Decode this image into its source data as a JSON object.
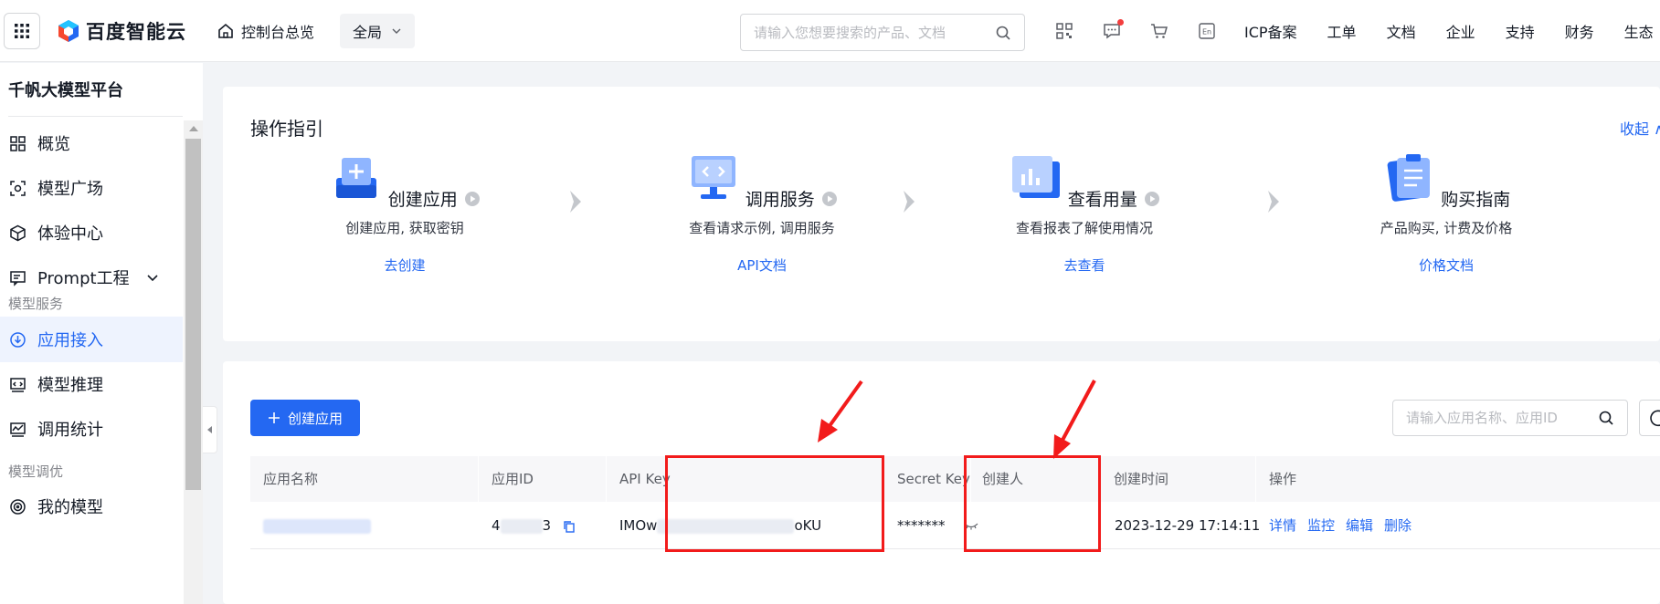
{
  "topbar": {
    "logo_text": "百度智能云",
    "console_label": "控制台总览",
    "region_label": "全局",
    "search_placeholder": "请输入您想要搜索的产品、文档",
    "nav": [
      "ICP备案",
      "工单",
      "文档",
      "企业",
      "支持",
      "财务",
      "生态"
    ],
    "icons": [
      "qrcode-icon",
      "message-icon",
      "cart-icon",
      "language-icon"
    ]
  },
  "sidebar": {
    "title": "千帆大模型平台",
    "items": [
      {
        "label": "概览",
        "icon": "grid-icon"
      },
      {
        "label": "模型广场",
        "icon": "model-icon"
      },
      {
        "label": "体验中心",
        "icon": "cube-icon"
      },
      {
        "label": "Prompt工程",
        "icon": "prompt-icon"
      }
    ],
    "group_model_service": "模型服务",
    "service_items": [
      {
        "label": "应用接入",
        "icon": "download-circle-icon",
        "active": true
      },
      {
        "label": "模型推理",
        "icon": "code-window-icon"
      },
      {
        "label": "调用统计",
        "icon": "chart-icon"
      }
    ],
    "group_model_tuning": "模型调优",
    "tuning_items": [
      {
        "label": "我的模型",
        "icon": "target-icon"
      }
    ]
  },
  "guide": {
    "title": "操作指引",
    "collapse_label": "收起",
    "steps": [
      {
        "name": "创建应用",
        "desc": "创建应用, 获取密钥",
        "link": "去创建"
      },
      {
        "name": "调用服务",
        "desc": "查看请求示例, 调用服务",
        "link": "API文档"
      },
      {
        "name": "查看用量",
        "desc": "查看报表了解使用情况",
        "link": "去查看"
      },
      {
        "name": "购买指南",
        "desc": "产品购买, 计费及价格",
        "link": "价格文档"
      }
    ]
  },
  "apps": {
    "create_label": "创建应用",
    "search_placeholder": "请输入应用名称、应用ID",
    "columns": [
      "应用名称",
      "应用ID",
      "API Key",
      "Secret Key",
      "创建人",
      "创建时间",
      "操作"
    ],
    "row": {
      "app_id_prefix": "4",
      "app_id_suffix": "3",
      "api_key_prefix": "IMOw",
      "api_key_suffix": "oKU",
      "secret_masked": "*******",
      "created_at": "2023-12-29 17:14:11",
      "ops": [
        "详情",
        "监控",
        "编辑",
        "删除"
      ]
    }
  },
  "colors": {
    "accent": "#2468f2",
    "annotation_red": "#f21b1b"
  }
}
